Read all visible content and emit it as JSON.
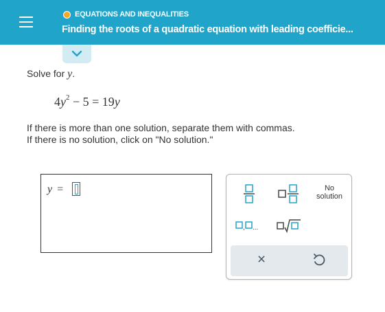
{
  "header": {
    "topic": "EQUATIONS AND INEQUALITIES",
    "title": "Finding the roots of a quadratic equation with leading coefficie...",
    "color": "#20a4c9",
    "topic_dot_color": "#f7a823"
  },
  "problem": {
    "prompt": "Solve for",
    "variable": "y",
    "prompt_end": ".",
    "equation": {
      "coefficient": "4",
      "variable": "y",
      "exponent": "2",
      "rest_lhs": " − 5 = 19",
      "rhs_variable": "y"
    },
    "instruction_1": "If there is more than one solution, separate them with commas.",
    "instruction_2": "If there is no solution, click on \"No solution.\""
  },
  "answer": {
    "variable": "y",
    "equals": "=",
    "value": ""
  },
  "keypad": {
    "keys": [
      "fraction-icon",
      "mixed-number-icon",
      "no-solution",
      "list-icon",
      "nth-root-icon"
    ],
    "no_solution_line1": "No",
    "no_solution_line2": "solution",
    "list_ellipsis": "...",
    "clear_label": "×",
    "accent": "#20a4c9"
  }
}
